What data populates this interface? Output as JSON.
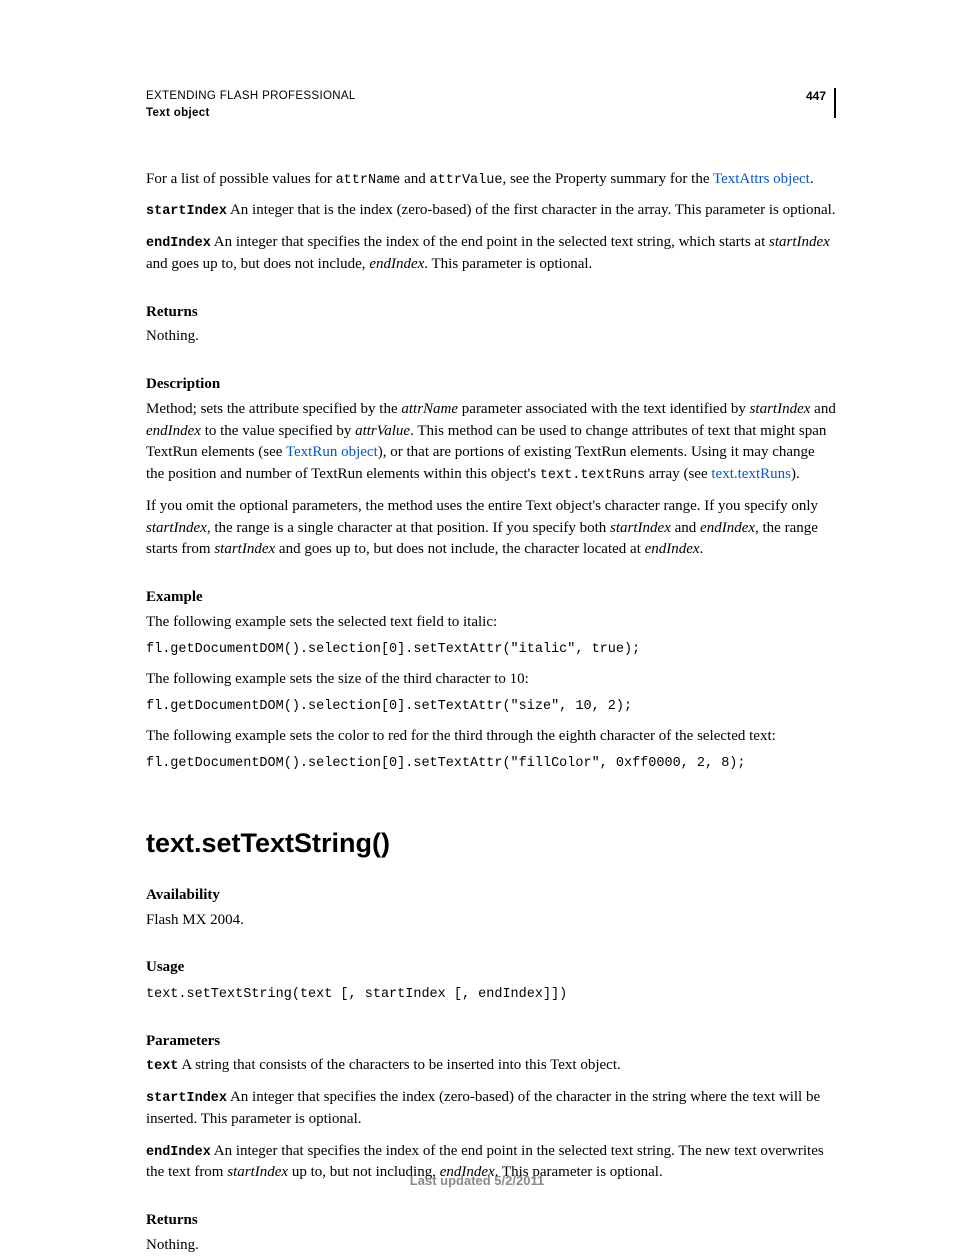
{
  "header": {
    "title": "EXTENDING FLASH PROFESSIONAL",
    "sub": "Text object",
    "page": "447"
  },
  "intro": {
    "t1": "For a list of possible values for ",
    "c1": "attrName",
    "t2": " and ",
    "c2": "attrValue",
    "t3": ", see the Property summary for the ",
    "link": "TextAttrs object",
    "t4": "."
  },
  "startIndex": {
    "label": "startIndex",
    "text": "  An integer that is the index (zero-based) of the first character in the array. This parameter is optional."
  },
  "endIndex": {
    "label": "endIndex",
    "t1": "  An integer that specifies the index of the end point in the selected text string, which starts at ",
    "i1": "startIndex",
    "t2": " and goes up to, but does not include, ",
    "i2": "endIndex",
    "t3": ". This parameter is optional."
  },
  "returns": {
    "label": "Returns",
    "text": "Nothing."
  },
  "desc": {
    "label": "Description",
    "p1a": "Method; sets the attribute specified by the ",
    "p1i1": "attrName",
    "p1b": " parameter associated with the text identified by ",
    "p1i2": "startIndex",
    "p1c": " and ",
    "p1i3": "endIndex",
    "p1d": " to the value specified by ",
    "p1i4": "attrValue",
    "p1e": ". This method can be used to change attributes of text that might span TextRun elements (see ",
    "p1link1": "TextRun object",
    "p1f": "), or that are portions of existing TextRun elements. Using it may change the position and number of TextRun elements within this object's ",
    "p1code": "text.textRuns",
    "p1g": " array (see ",
    "p1link2": "text.textRuns",
    "p1h": ").",
    "p2a": "If you omit the optional parameters, the method uses the entire Text object's character range. If you specify only ",
    "p2i1": "startIndex",
    "p2b": ", the range is a single character at that position. If you specify both ",
    "p2i2": "startIndex",
    "p2c": " and ",
    "p2i3": "endIndex",
    "p2d": ", the range starts from ",
    "p2i4": "startIndex",
    "p2e": " and goes up to, but does not include, the character located at ",
    "p2i5": "endIndex",
    "p2f": "."
  },
  "example": {
    "label": "Example",
    "t1": "The following example sets the selected text field to italic:",
    "c1": "fl.getDocumentDOM().selection[0].setTextAttr(\"italic\", true);",
    "t2": "The following example sets the size of the third character to 10:",
    "c2": "fl.getDocumentDOM().selection[0].setTextAttr(\"size\", 10, 2);",
    "t3": "The following example sets the color to red for the third through the eighth character of the selected text:",
    "c3": "fl.getDocumentDOM().selection[0].setTextAttr(\"fillColor\", 0xff0000, 2, 8);"
  },
  "method2": {
    "title": "text.setTextString()",
    "avail": {
      "label": "Availability",
      "text": "Flash MX 2004."
    },
    "usage": {
      "label": "Usage",
      "code": "text.setTextString(text [, startIndex [, endIndex]])"
    },
    "params": {
      "label": "Parameters",
      "text": {
        "label": "text",
        "body": "  A string that consists of the characters to be inserted into this Text object."
      },
      "start": {
        "label": "startIndex",
        "body": "  An integer that specifies the index (zero-based) of the character in the string where the text will be inserted. This parameter is optional."
      },
      "end": {
        "label": "endIndex",
        "t1": "  An integer that specifies the index of the end point in the selected text string. The new text overwrites the text from ",
        "i1": "startIndex",
        "t2": " up to, but not including, ",
        "i2": "endIndex",
        "t3": ". This parameter is optional."
      }
    },
    "returns": {
      "label": "Returns",
      "text": "Nothing."
    }
  },
  "footer": "Last updated 5/2/2011"
}
